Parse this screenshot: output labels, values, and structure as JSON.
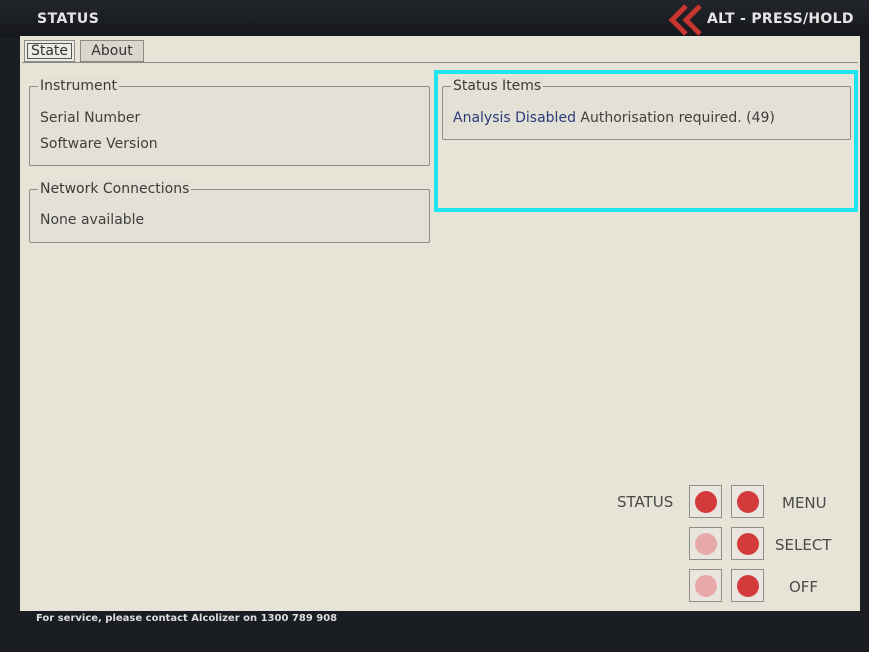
{
  "header": {
    "title": "STATUS",
    "alt_hint": "ALT - PRESS/HOLD",
    "chevron_icon": "double-chevron-left-icon",
    "accent_color": "#c8342e"
  },
  "tabs": [
    {
      "label": "State",
      "active": true
    },
    {
      "label": "About",
      "active": false
    }
  ],
  "instrument": {
    "legend": "Instrument",
    "serial_label": "Serial Number",
    "software_label": "Software Version"
  },
  "network": {
    "legend": "Network Connections",
    "value": "None available"
  },
  "status_items": {
    "legend": "Status Items",
    "item_title": "Analysis Disabled",
    "item_detail": "Authorisation required. (49)",
    "highlight_color": "#1fe4ee"
  },
  "hardware_buttons": {
    "status_label": "STATUS",
    "menu_label": "MENU",
    "select_label": "SELECT",
    "off_label": "OFF",
    "active_color": "#d33a3a",
    "inactive_color": "#e8aaa8"
  },
  "footer": {
    "text": "For service, please contact Alcolizer on 1300 789 908"
  }
}
